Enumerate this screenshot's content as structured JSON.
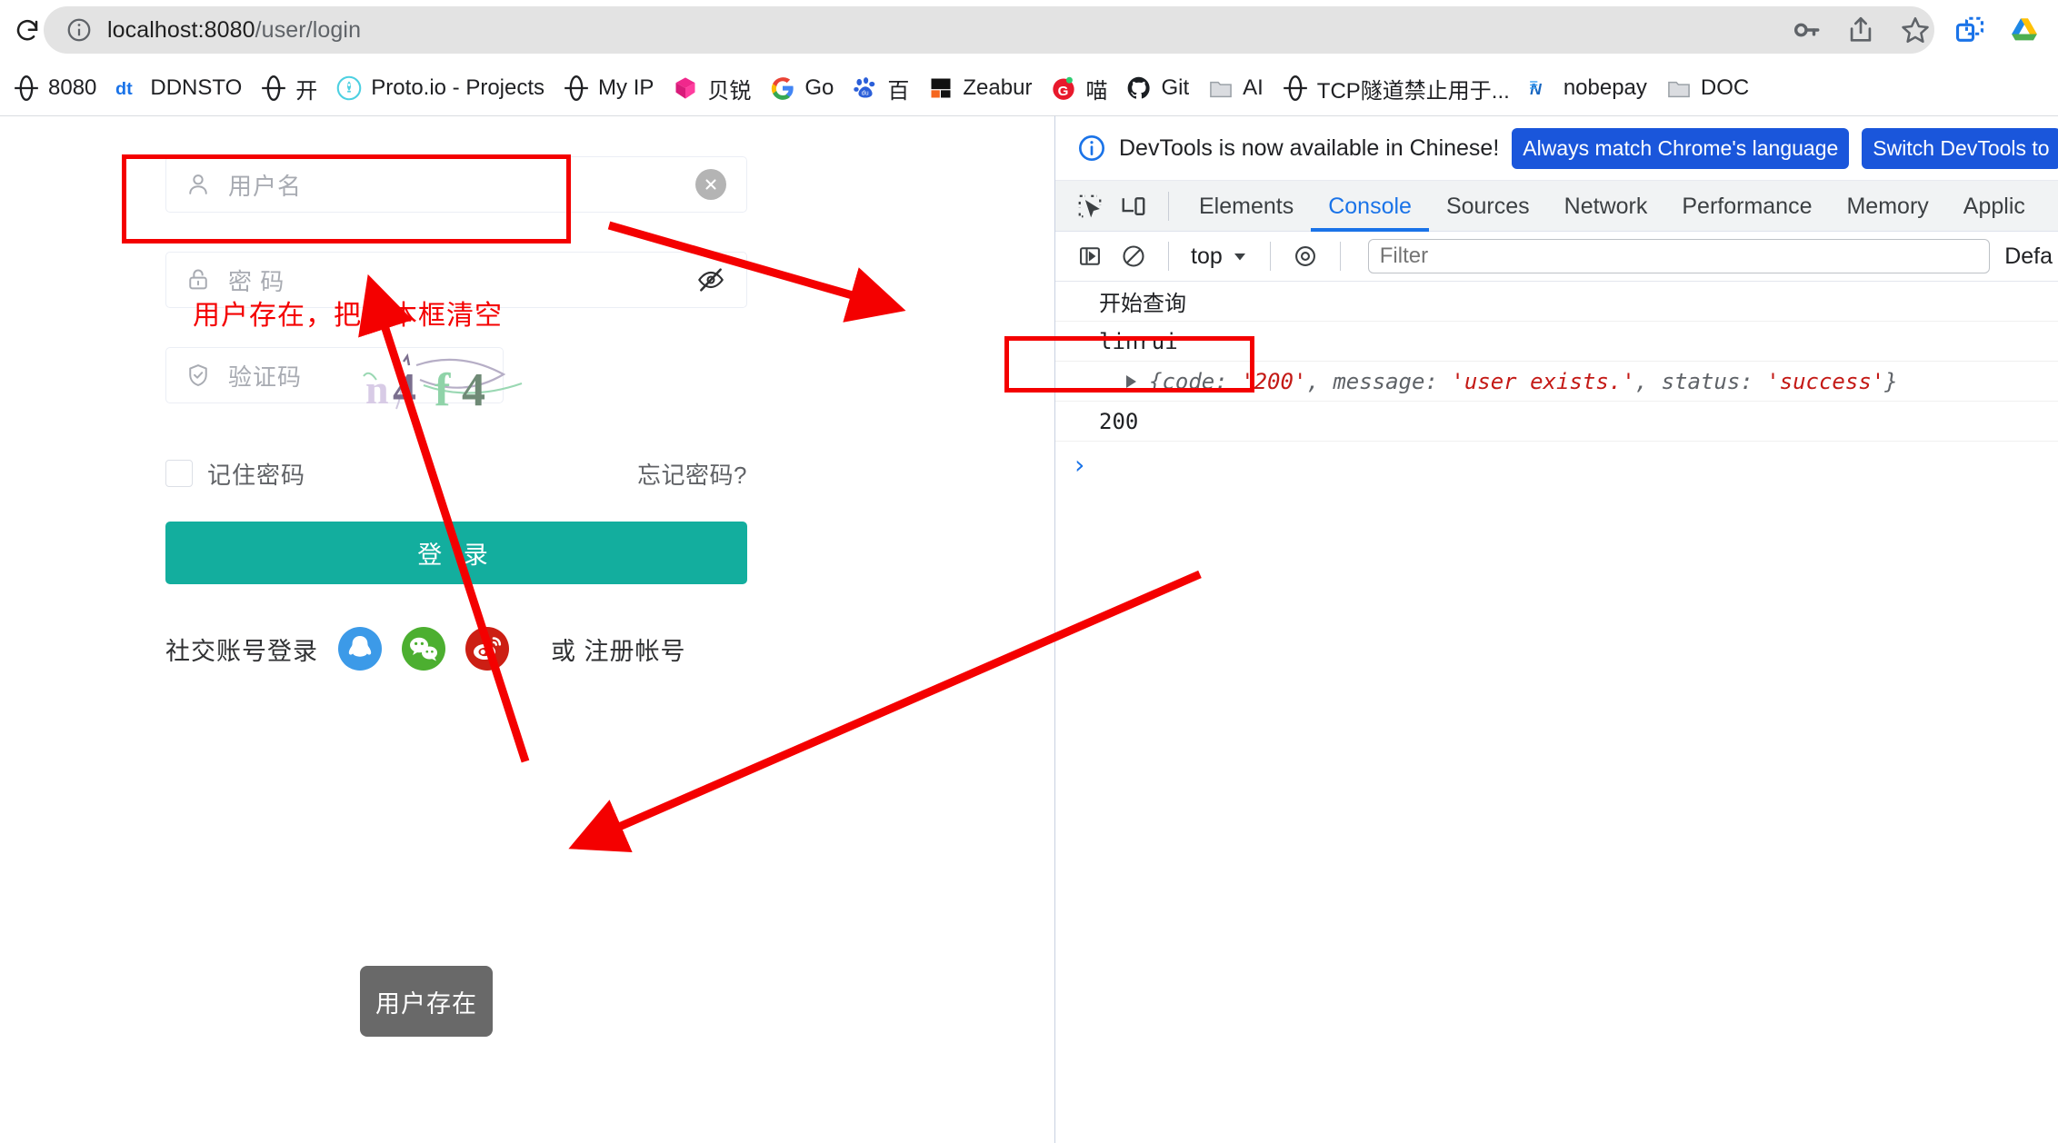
{
  "browser": {
    "reload_icon": "reload-icon",
    "url_prefix": "localhost:8080",
    "url_path": "/user/login",
    "info_icon": "page-info-icon",
    "toolbar_icons": [
      "password-key-icon",
      "share-icon",
      "bookmark-star-icon",
      "split-tab-icon",
      "google-drive-icon"
    ]
  },
  "bookmarks": [
    {
      "label": "8080",
      "icon": "globe-icon"
    },
    {
      "label": "DDNSTO",
      "icon": "ddnsto-icon"
    },
    {
      "label": "开",
      "icon": "globe-icon"
    },
    {
      "label": "Proto.io - Projects",
      "icon": "protoio-icon"
    },
    {
      "label": "My IP",
      "icon": "globe-icon"
    },
    {
      "label": "贝锐",
      "icon": "beirui-icon"
    },
    {
      "label": "Go",
      "icon": "google-icon"
    },
    {
      "label": "百",
      "icon": "baidu-icon"
    },
    {
      "label": "Zeabur",
      "icon": "zeabur-icon"
    },
    {
      "label": "喵",
      "icon": "miao-icon"
    },
    {
      "label": "Git",
      "icon": "github-icon"
    },
    {
      "label": "AI",
      "icon": "folder-icon"
    },
    {
      "label": "TCP隧道禁止用于...",
      "icon": "globe-icon"
    },
    {
      "label": "nobepay",
      "icon": "nobepay-icon"
    },
    {
      "label": "DOC",
      "icon": "folder-icon"
    }
  ],
  "login": {
    "username": {
      "placeholder": "用户名",
      "icon": "user-icon",
      "clear_icon": "clear-circle-icon",
      "value": ""
    },
    "password": {
      "placeholder": "密 码",
      "icon": "lock-icon",
      "toggle_icon": "eye-off-icon",
      "value": ""
    },
    "captcha": {
      "placeholder": "验证码",
      "icon": "shield-check-icon",
      "value": "",
      "image_text": "n4f4"
    },
    "remember_label": "记住密码",
    "remember_checked": false,
    "forgot_label": "忘记密码?",
    "submit_label": "登 录",
    "submit_color": "#13ae9e",
    "social_label": "社交账号登录",
    "social_icons": [
      "qq-icon",
      "wechat-icon",
      "weibo-icon"
    ],
    "register_text": "或 注册帐号"
  },
  "toast": {
    "text": "用户存在",
    "bg": "#696969"
  },
  "annotations": {
    "note_text": "用户存在，把文本框清空",
    "color": "#f40000"
  },
  "devtools": {
    "banner": {
      "icon": "info-circle-icon",
      "text": "DevTools is now available in Chinese!",
      "buttons": [
        "Always match Chrome's language",
        "Switch DevTools to"
      ]
    },
    "tool_icons": [
      "inspect-element-icon",
      "device-toolbar-icon"
    ],
    "tabs": [
      {
        "label": "Elements",
        "active": false
      },
      {
        "label": "Console",
        "active": true
      },
      {
        "label": "Sources",
        "active": false
      },
      {
        "label": "Network",
        "active": false
      },
      {
        "label": "Performance",
        "active": false
      },
      {
        "label": "Memory",
        "active": false
      },
      {
        "label": "Applic",
        "active": false
      }
    ],
    "subbar": {
      "sidebar_icon": "console-sidebar-icon",
      "clear_icon": "clear-console-icon",
      "context": "top",
      "chevron_icon": "chevron-down-icon",
      "eye_icon": "live-expression-icon",
      "filter_placeholder": "Filter",
      "levels_label": "Defa"
    },
    "console_rows": [
      {
        "type": "log",
        "text": "开始查询"
      },
      {
        "type": "log",
        "text": "linrui"
      },
      {
        "type": "object",
        "open_brace": "{",
        "close_brace": "}",
        "pairs": [
          {
            "key": "code",
            "value": "'200'"
          },
          {
            "key": "message",
            "value": "'user exists.'"
          },
          {
            "key": "status",
            "value": "'success'"
          }
        ]
      },
      {
        "type": "log",
        "text": "200"
      }
    ],
    "prompt_glyph": "›"
  }
}
